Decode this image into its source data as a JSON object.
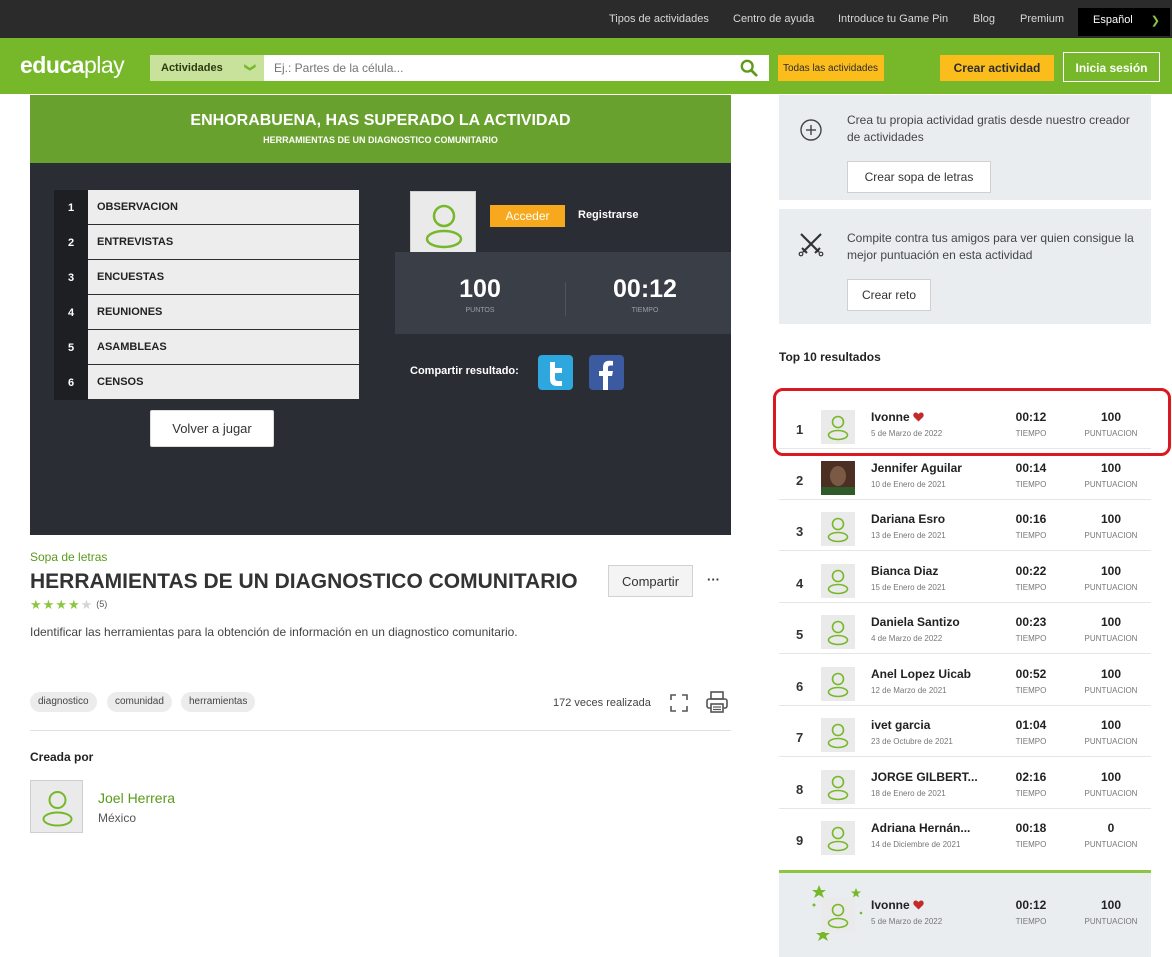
{
  "topnav": {
    "items": [
      "Tipos de actividades",
      "Centro de ayuda",
      "Introduce tu Game Pin",
      "Blog",
      "Premium"
    ],
    "language": "Español"
  },
  "header": {
    "logo_a": "educa",
    "logo_b": "play",
    "activities_label": "Actividades",
    "search_placeholder": "Ej.: Partes de la célula...",
    "all_activities": "Todas las actividades",
    "create_activity": "Crear actividad",
    "login": "Inicia sesión"
  },
  "game": {
    "congrats": "ENHORABUENA, HAS SUPERADO LA ACTIVIDAD",
    "subtitle": "HERRAMIENTAS DE UN DIAGNOSTICO COMUNITARIO",
    "words": [
      {
        "num": "1",
        "word": "OBSERVACION"
      },
      {
        "num": "2",
        "word": "ENTREVISTAS"
      },
      {
        "num": "3",
        "word": "ENCUESTAS"
      },
      {
        "num": "4",
        "word": "REUNIONES"
      },
      {
        "num": "5",
        "word": "ASAMBLEAS"
      },
      {
        "num": "6",
        "word": "CENSOS"
      }
    ],
    "replay": "Volver a jugar",
    "login": "Acceder",
    "register": "Registrarse",
    "points": "100",
    "points_label": "PUNTOS",
    "time": "00:12",
    "time_label": "TIEMPO",
    "share_label": "Compartir resultado:"
  },
  "activity": {
    "category": "Sopa de letras",
    "title": "HERRAMIENTAS DE UN DIAGNOSTICO COMUNITARIO",
    "rating": 4,
    "rating_max": 5,
    "rating_count": "(5)",
    "description": "Identificar las herramientas para la obtención de información en un diagnostico comunitario.",
    "share": "Compartir",
    "more": "···",
    "tags": [
      "diagnostico",
      "comunidad",
      "herramientas"
    ],
    "times_played": "172 veces realizada",
    "created_by": "Creada por",
    "author_name": "Joel Herrera",
    "author_country": "México"
  },
  "sidebar": {
    "create_text": "Crea tu propia actividad gratis desde nuestro creador de actividades",
    "create_button": "Crear sopa de letras",
    "challenge_text": "Compite contra tus amigos para ver quien consigue la mejor puntuación en esta actividad",
    "challenge_button": "Crear reto",
    "top10_title": "Top 10 resultados",
    "time_label": "TIEMPO",
    "score_label": "PUNTUACION",
    "results": [
      {
        "rank": "1",
        "name": "Ivonne",
        "date": "5 de Marzo de 2022",
        "time": "00:12",
        "score": "100"
      },
      {
        "rank": "2",
        "name": "Jennifer Aguilar",
        "date": "10 de Enero de 2021",
        "time": "00:14",
        "score": "100"
      },
      {
        "rank": "3",
        "name": "Dariana Esro",
        "date": "13 de Enero de 2021",
        "time": "00:16",
        "score": "100"
      },
      {
        "rank": "4",
        "name": "Bianca Diaz",
        "date": "15 de Enero de 2021",
        "time": "00:22",
        "score": "100"
      },
      {
        "rank": "5",
        "name": "Daniela Santizo",
        "date": "4 de Marzo de 2022",
        "time": "00:23",
        "score": "100"
      },
      {
        "rank": "6",
        "name": "Anel Lopez Uicab",
        "date": "12 de Marzo de 2021",
        "time": "00:52",
        "score": "100"
      },
      {
        "rank": "7",
        "name": "ivet garcia",
        "date": "23 de Octubre de 2021",
        "time": "01:04",
        "score": "100"
      },
      {
        "rank": "8",
        "name": "JORGE GILBERT...",
        "date": "18 de Enero de 2021",
        "time": "02:16",
        "score": "100"
      },
      {
        "rank": "9",
        "name": "Adriana Hernán...",
        "date": "14 de Diciembre de 2021",
        "time": "00:18",
        "score": "0"
      }
    ],
    "my_result": {
      "name": "Ivonne",
      "date": "5 de Marzo de 2022",
      "time": "00:12",
      "score": "100"
    }
  },
  "colors": {
    "brand_green": "#76b82a",
    "accent_yellow": "#fbbd1c",
    "dark_panel": "#2a2d33",
    "highlight_red": "#d9181f"
  }
}
